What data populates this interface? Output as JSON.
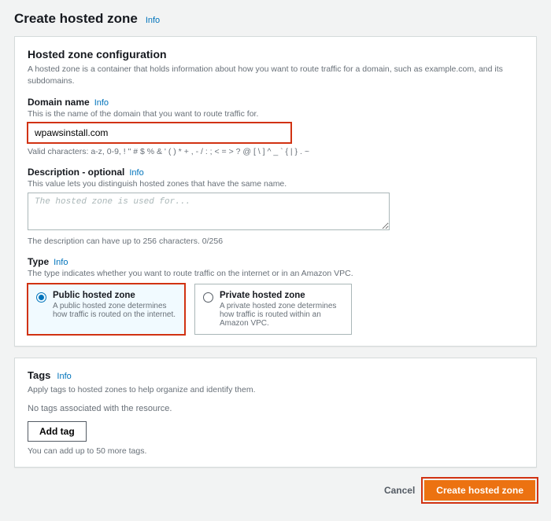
{
  "info_label": "Info",
  "page": {
    "title": "Create hosted zone"
  },
  "config": {
    "heading": "Hosted zone configuration",
    "description": "A hosted zone is a container that holds information about how you want to route traffic for a domain, such as example.com, and its subdomains.",
    "domain": {
      "label": "Domain name",
      "hint": "This is the name of the domain that you want to route traffic for.",
      "value": "wpawsinstall.com",
      "valid_chars": "Valid characters: a-z, 0-9, ! \" # $ % & ' ( ) * + , - / : ; < = > ? @ [ \\ ] ^ _ ` { | } . ~"
    },
    "descfield": {
      "label": "Description - optional",
      "hint": "This value lets you distinguish hosted zones that have the same name.",
      "placeholder": "The hosted zone is used for...",
      "counter": "The description can have up to 256 characters. 0/256"
    },
    "type": {
      "label": "Type",
      "hint": "The type indicates whether you want to route traffic on the internet or in an Amazon VPC.",
      "options": [
        {
          "title": "Public hosted zone",
          "desc": "A public hosted zone determines how traffic is routed on the internet.",
          "selected": true
        },
        {
          "title": "Private hosted zone",
          "desc": "A private hosted zone determines how traffic is routed within an Amazon VPC.",
          "selected": false
        }
      ]
    }
  },
  "tags": {
    "heading": "Tags",
    "description": "Apply tags to hosted zones to help organize and identify them.",
    "empty": "No tags associated with the resource.",
    "add_label": "Add tag",
    "limit": "You can add up to 50 more tags."
  },
  "footer": {
    "cancel": "Cancel",
    "submit": "Create hosted zone"
  }
}
